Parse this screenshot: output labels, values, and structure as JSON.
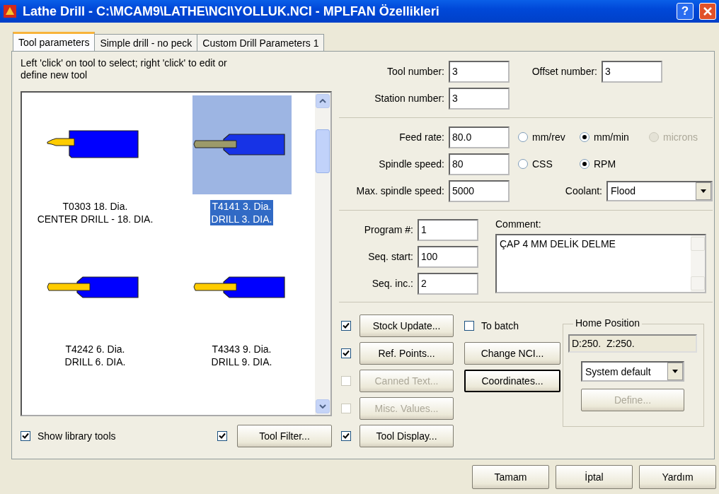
{
  "window": {
    "title": "Lathe Drill - C:\\MCAM9\\LATHE\\NCI\\YOLLUK.NCI - MPLFAN Özellikleri",
    "help": "?"
  },
  "tabs": [
    {
      "label": "Tool parameters",
      "selected": true
    },
    {
      "label": "Simple drill - no peck",
      "selected": false
    },
    {
      "label": "Custom Drill Parameters 1",
      "selected": false
    }
  ],
  "tool_list": {
    "hint": "Left 'click' on tool to select; right 'click' to edit or define new tool",
    "tools": [
      {
        "kind": "center_drill",
        "line_1": "T0303 18. Dia.",
        "line_2": "CENTER DRILL - 18. DIA.",
        "selected": false
      },
      {
        "kind": "drill",
        "line_1": "T4141 3. Dia.",
        "line_2": "DRILL 3. DIA.",
        "selected": true
      },
      {
        "kind": "drill",
        "line_1": "T4242 6. Dia.",
        "line_2": "DRILL 6. DIA.",
        "selected": false
      },
      {
        "kind": "drill",
        "line_1": "T4343 9. Dia.",
        "line_2": "DRILL 9. DIA.",
        "selected": false
      }
    ]
  },
  "show_library_tools": {
    "label": "Show library tools",
    "checked": true
  },
  "tool_filter": {
    "label": "Tool Filter...",
    "checked": true
  },
  "tool_number": {
    "label": "Tool number:",
    "value": "3"
  },
  "offset_number": {
    "label": "Offset number:",
    "value": "3"
  },
  "station_number": {
    "label": "Station number:",
    "value": "3"
  },
  "feed_rate": {
    "label": "Feed rate:",
    "value": "80.0",
    "units": [
      {
        "label": "mm/rev",
        "selected": false,
        "disabled": false
      },
      {
        "label": "mm/min",
        "selected": true,
        "disabled": false
      },
      {
        "label": "microns",
        "selected": false,
        "disabled": true
      }
    ]
  },
  "spindle_speed": {
    "label": "Spindle speed:",
    "value": "80",
    "modes": [
      {
        "label": "CSS",
        "selected": false
      },
      {
        "label": "RPM",
        "selected": true
      }
    ]
  },
  "max_spindle_speed": {
    "label": "Max. spindle speed:",
    "value": "5000"
  },
  "coolant": {
    "label": "Coolant:",
    "value": "Flood"
  },
  "program_fields": [
    {
      "label": "Program #:",
      "value": "1"
    },
    {
      "label": "Seq. start:",
      "value": "100"
    },
    {
      "label": "Seq. inc.:",
      "value": "2"
    }
  ],
  "comment": {
    "label": "Comment:",
    "value": "ÇAP 4 MM DELİK DELME"
  },
  "option_buttons": [
    {
      "label": "Stock Update...",
      "checked": true,
      "disabled": false
    },
    {
      "label": "Ref. Points...",
      "checked": true,
      "disabled": false
    },
    {
      "label": "Canned Text...",
      "checked": false,
      "disabled": true
    },
    {
      "label": "Misc. Values...",
      "checked": false,
      "disabled": true
    },
    {
      "label": "Tool Display...",
      "checked": true,
      "disabled": false
    }
  ],
  "to_batch": {
    "label": "To batch",
    "checked": false
  },
  "nci_buttons": [
    {
      "label": "Change NCI...",
      "default": false
    },
    {
      "label": "Coordinates...",
      "default": true
    }
  ],
  "home_position": {
    "title": "Home Position",
    "value": "D:250.  Z:250.",
    "mode": "System default",
    "define": {
      "label": "Define...",
      "disabled": true
    }
  },
  "dialog_buttons": [
    "Tamam",
    "İptal",
    "Yardım"
  ]
}
